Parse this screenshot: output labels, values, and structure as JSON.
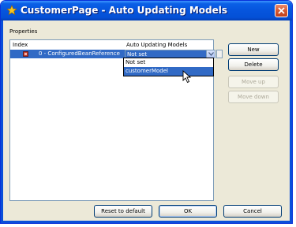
{
  "window": {
    "title": "CustomerPage - Auto Updating Models",
    "title_color": "#ffffff",
    "titlebar_color": "#0655dd"
  },
  "properties": {
    "group_label": "Properties",
    "columns": [
      "Index",
      "Auto Updating Models"
    ],
    "rows": [
      {
        "name": "0 - ConfiguredBeanReference",
        "value": "Not set",
        "selected": true
      }
    ],
    "dropdown": {
      "options": [
        "Not set",
        "customerModel"
      ],
      "highlighted": "customerModel"
    }
  },
  "side_buttons": {
    "new": "New",
    "delete": "Delete",
    "move_up": "Move up",
    "move_down": "Move down"
  },
  "footer": {
    "reset": "Reset to default",
    "ok": "OK",
    "cancel": "Cancel"
  },
  "colors": {
    "selection": "#316ac5",
    "dialog_bg": "#ece9d8",
    "close_button": "#d65a32"
  }
}
